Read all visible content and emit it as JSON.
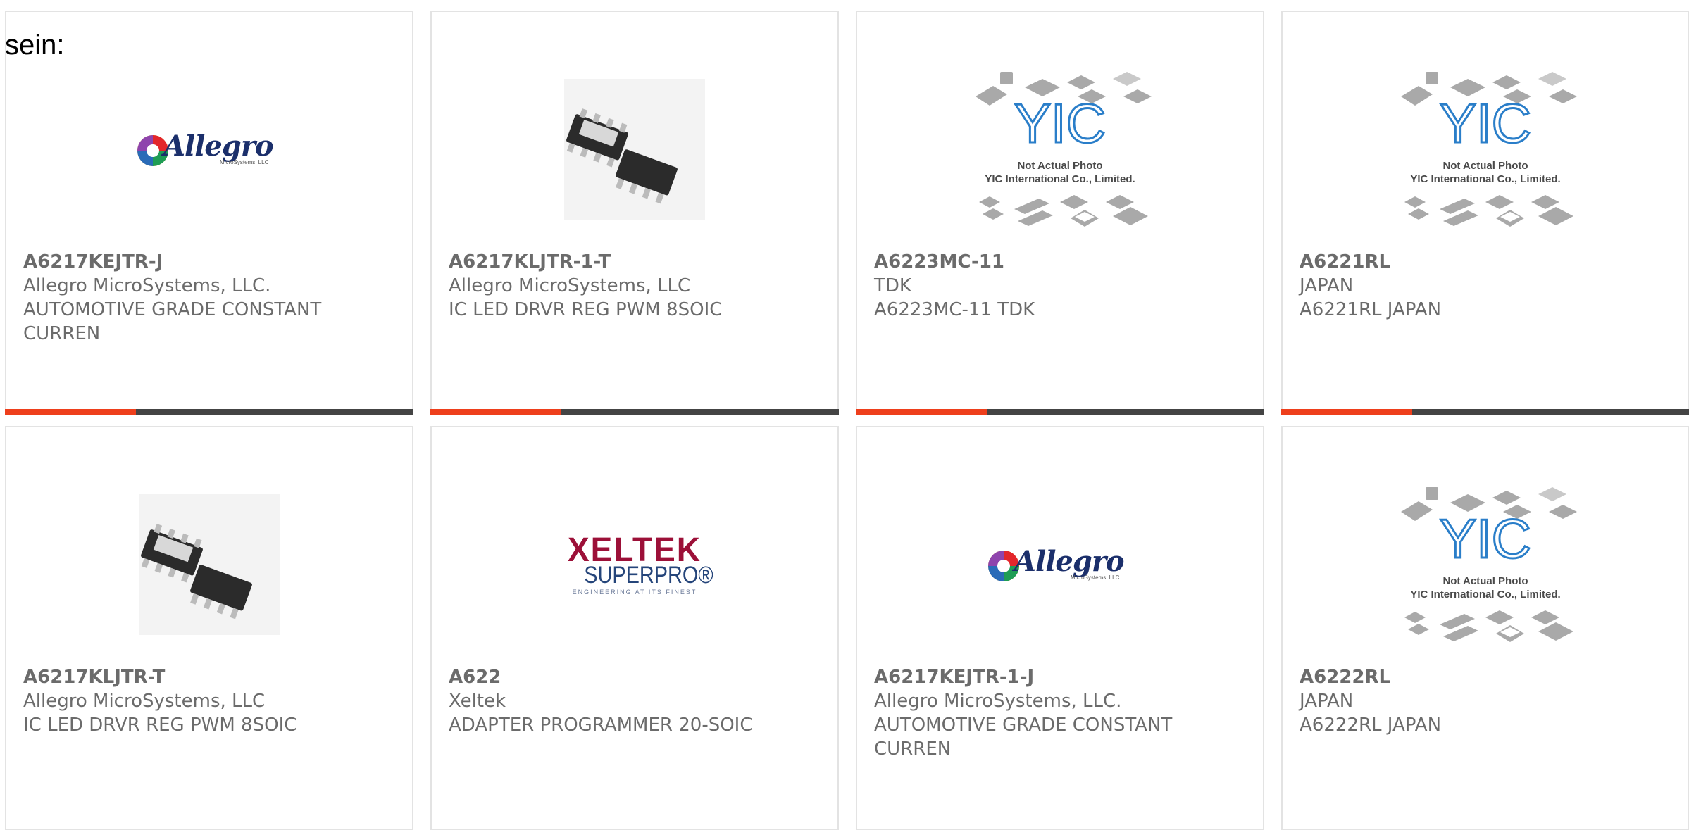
{
  "intro_text": "sein:",
  "not_actual_photo": "Not Actual Photo",
  "yic_company": "YIC International Co., Limited.",
  "yic_logo": "YIC",
  "allegro_word": "Allegro",
  "allegro_sub": "MicroSystems, LLC",
  "xeltek_word": "XELTEK",
  "xeltek_sub": "SUPERPRO®",
  "xeltek_tag": "ENGINEERING AT ITS FINEST",
  "colors": {
    "accent": "#ee3f1c",
    "bar_track": "#444444",
    "text": "#6b6b6b"
  },
  "products": [
    {
      "part_number": "A6217KEJTR-J",
      "manufacturer": "Allegro MicroSystems, LLC.",
      "description": "AUTOMOTIVE GRADE CONSTANT CURREN",
      "image": "allegro-logo",
      "progress": 0.32
    },
    {
      "part_number": "A6217KLJTR-1-T",
      "manufacturer": "Allegro MicroSystems, LLC",
      "description": "IC LED DRVR REG PWM 8SOIC",
      "image": "soic-chip-photo",
      "progress": 0.32
    },
    {
      "part_number": "A6223MC-11",
      "manufacturer": "TDK",
      "description": "A6223MC-11 TDK",
      "image": "yic-placeholder",
      "progress": 0.32
    },
    {
      "part_number": "A6221RL",
      "manufacturer": "JAPAN",
      "description": "A6221RL JAPAN",
      "image": "yic-placeholder",
      "progress": 0.32
    },
    {
      "part_number": "A6217KLJTR-T",
      "manufacturer": "Allegro MicroSystems, LLC",
      "description": "IC LED DRVR REG PWM 8SOIC",
      "image": "soic-chip-photo",
      "progress": null
    },
    {
      "part_number": "A622",
      "manufacturer": "Xeltek",
      "description": "ADAPTER PROGRAMMER 20-SOIC",
      "image": "xeltek-logo",
      "progress": null
    },
    {
      "part_number": "A6217KEJTR-1-J",
      "manufacturer": "Allegro MicroSystems, LLC.",
      "description": "AUTOMOTIVE GRADE CONSTANT CURREN",
      "image": "allegro-logo",
      "progress": null
    },
    {
      "part_number": "A6222RL",
      "manufacturer": "JAPAN",
      "description": "A6222RL JAPAN",
      "image": "yic-placeholder",
      "progress": null
    }
  ]
}
